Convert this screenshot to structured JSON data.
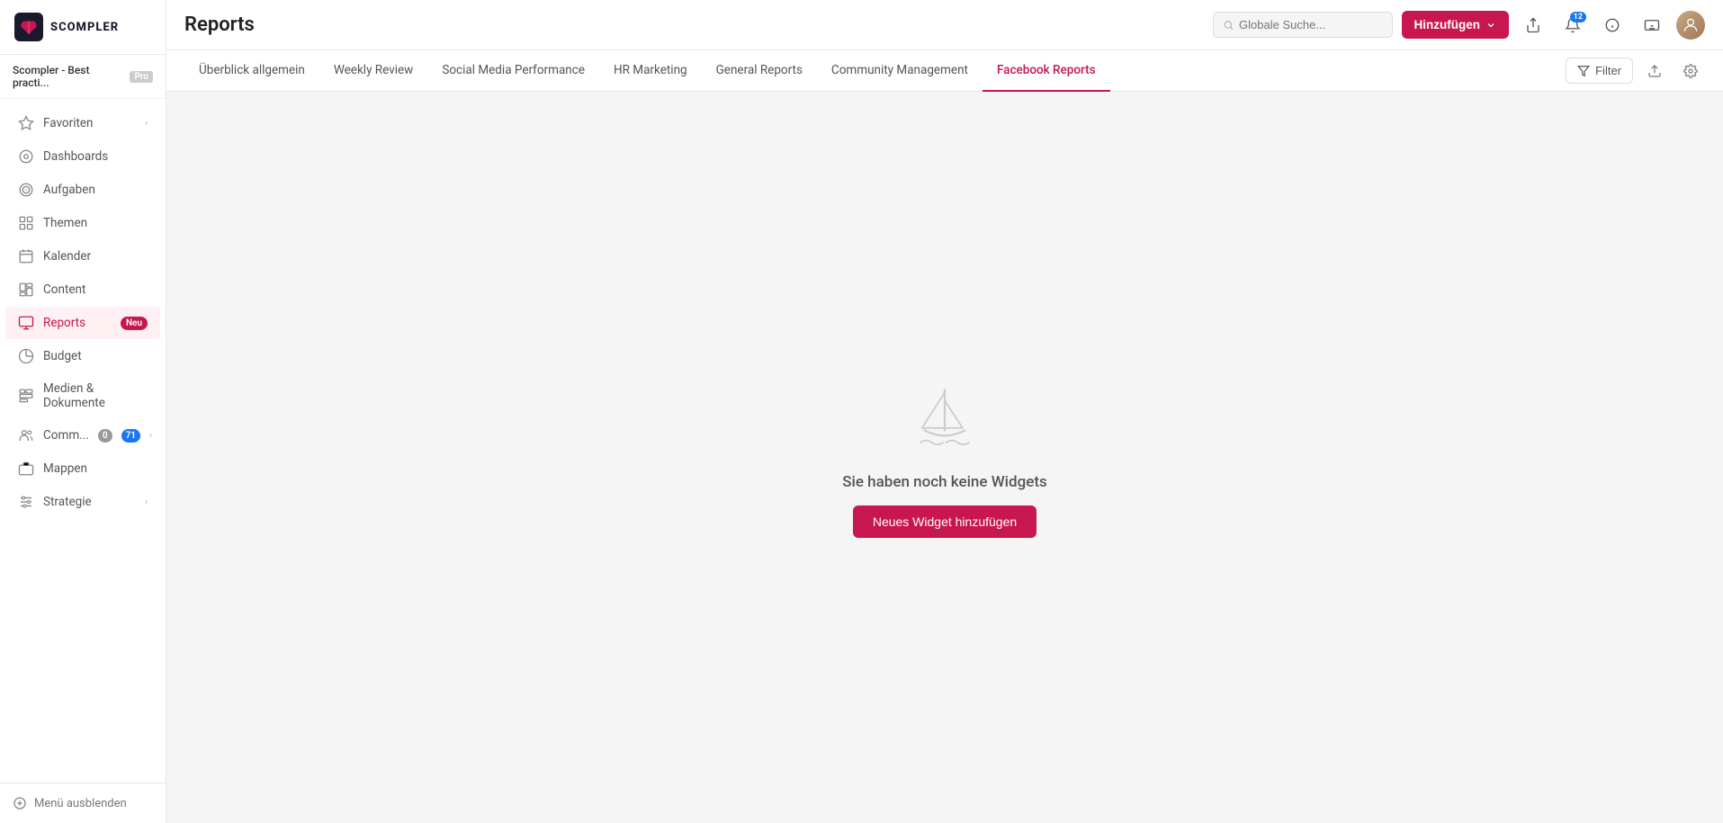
{
  "sidebar": {
    "logo_text": "SCOMPLER",
    "workspace": {
      "name": "Scompler - Best practi...",
      "badge": "Pro"
    },
    "nav_items": [
      {
        "id": "favoriten",
        "label": "Favoriten",
        "icon": "star",
        "has_chevron": true,
        "active": false
      },
      {
        "id": "dashboards",
        "label": "Dashboards",
        "icon": "circle",
        "active": false
      },
      {
        "id": "aufgaben",
        "label": "Aufgaben",
        "icon": "target",
        "active": false
      },
      {
        "id": "themen",
        "label": "Themen",
        "icon": "grid",
        "active": false
      },
      {
        "id": "kalender",
        "label": "Kalender",
        "icon": "calendar",
        "active": false
      },
      {
        "id": "content",
        "label": "Content",
        "icon": "grid2",
        "active": false
      },
      {
        "id": "reports",
        "label": "Reports",
        "icon": "monitor",
        "active": true,
        "badge": "Neu"
      },
      {
        "id": "budget",
        "label": "Budget",
        "icon": "pie",
        "active": false
      },
      {
        "id": "medien",
        "label": "Medien & Dokumente",
        "icon": "grid3",
        "active": false
      },
      {
        "id": "comm",
        "label": "Comm...",
        "icon": "users",
        "active": false,
        "badge1": "0",
        "badge2": "71",
        "has_chevron": true
      },
      {
        "id": "mappen",
        "label": "Mappen",
        "icon": "briefcase",
        "active": false
      },
      {
        "id": "strategie",
        "label": "Strategie",
        "icon": "sliders",
        "active": false,
        "has_chevron": true
      }
    ],
    "footer": {
      "label": "Menü ausblenden",
      "icon": "circle-plus"
    }
  },
  "header": {
    "title": "Reports",
    "search_placeholder": "Globale Suche...",
    "add_button_label": "Hinzufügen",
    "notification_count": "12"
  },
  "tabs": [
    {
      "id": "uberblick",
      "label": "Überblick allgemein",
      "active": false
    },
    {
      "id": "weekly",
      "label": "Weekly Review",
      "active": false
    },
    {
      "id": "social",
      "label": "Social Media Performance",
      "active": false
    },
    {
      "id": "hr",
      "label": "HR Marketing",
      "active": false
    },
    {
      "id": "general",
      "label": "General Reports",
      "active": false
    },
    {
      "id": "community",
      "label": "Community Management",
      "active": false
    },
    {
      "id": "facebook",
      "label": "Facebook Reports",
      "active": true
    }
  ],
  "tab_actions": {
    "filter_label": "Filter"
  },
  "empty_state": {
    "title": "Sie haben noch keine Widgets",
    "button_label": "Neues Widget hinzufügen"
  },
  "colors": {
    "accent": "#c8174e",
    "blue": "#1877f2"
  }
}
